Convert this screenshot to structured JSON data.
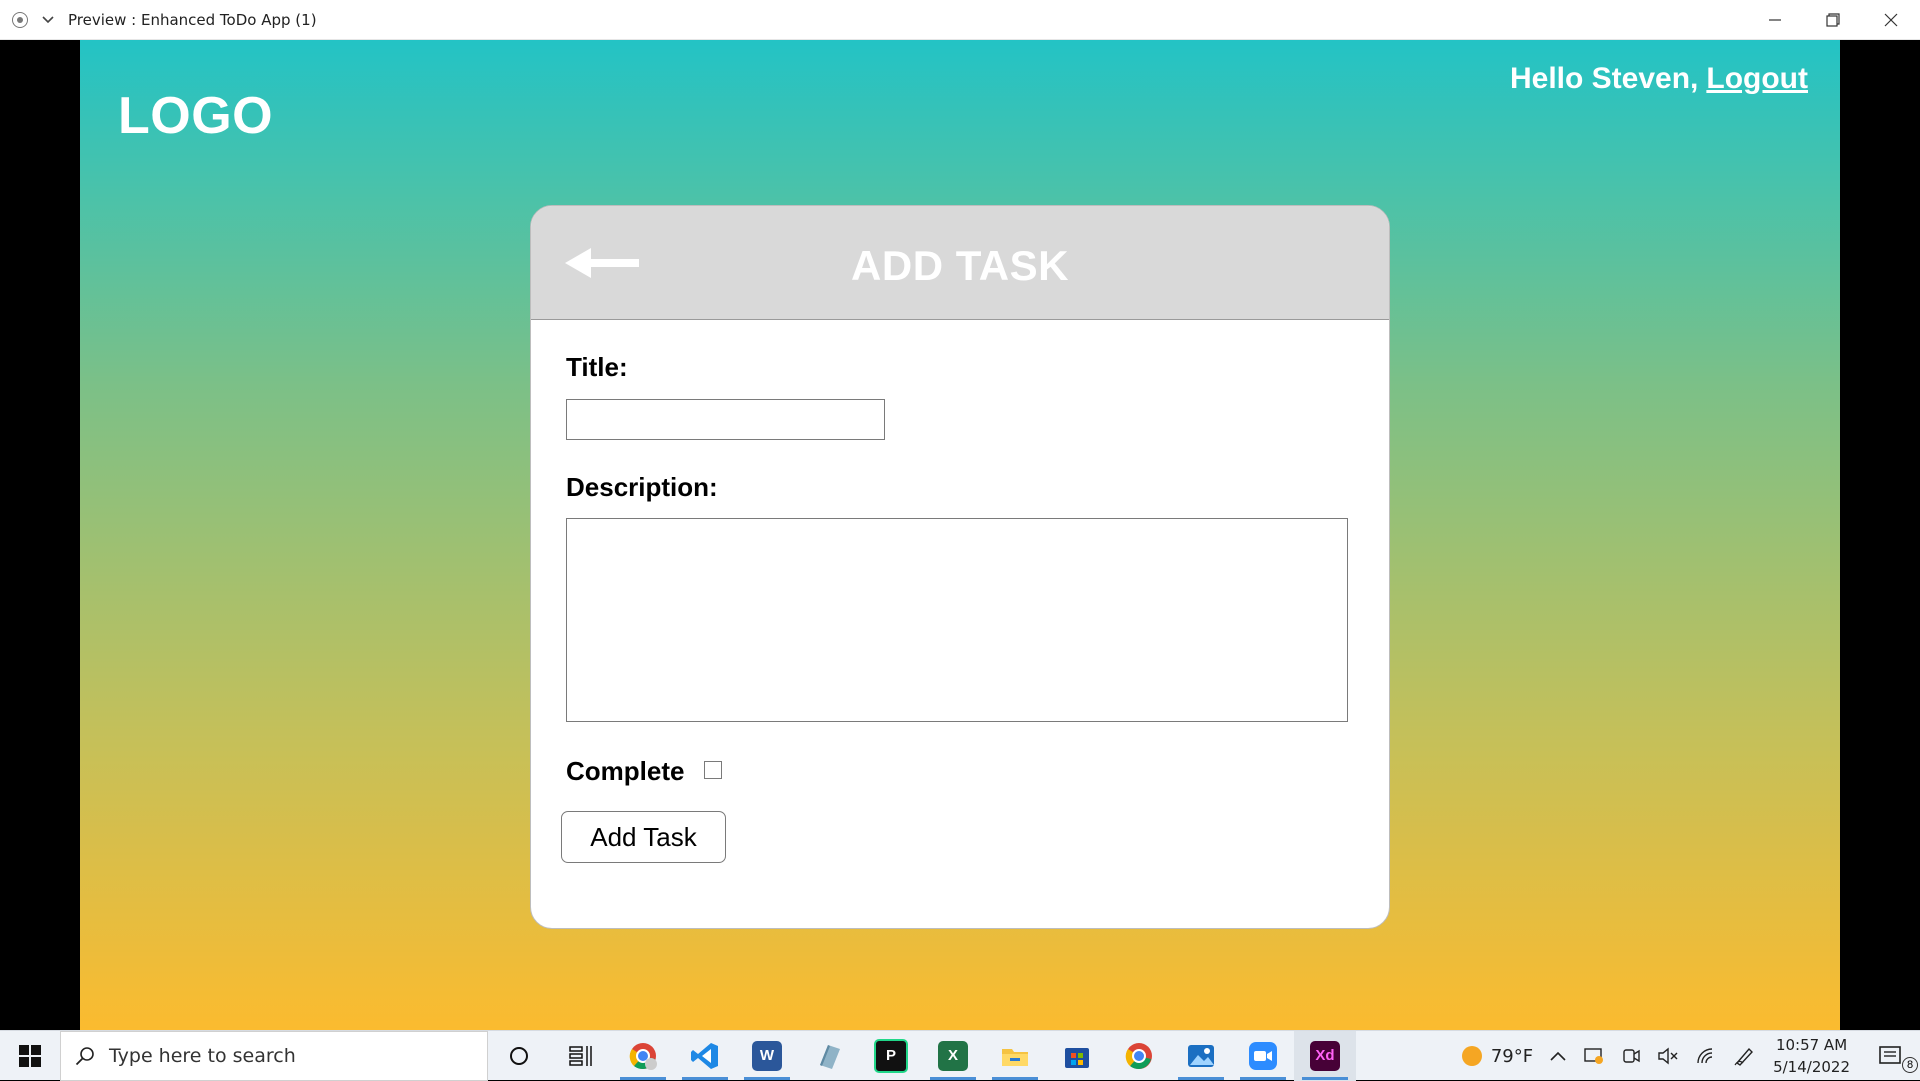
{
  "window": {
    "title": "Preview : Enhanced ToDo App (1)",
    "controls": [
      "minimize-icon",
      "restore-icon",
      "close-icon"
    ]
  },
  "header": {
    "logo": "LOGO",
    "greeting": "Hello Steven,",
    "logout_label": "Logout"
  },
  "card": {
    "title": "ADD TASK",
    "back_icon": "back-arrow-icon",
    "fields": {
      "title_label": "Title:",
      "title_value": "",
      "description_label": "Description:",
      "description_value": "",
      "complete_label": "Complete",
      "complete_checked": false
    },
    "submit_label": "Add Task"
  },
  "taskbar": {
    "search_placeholder": "Type here to search",
    "apps": [
      {
        "name": "chrome-profile",
        "active": true
      },
      {
        "name": "vscode",
        "active": true
      },
      {
        "name": "word",
        "label": "W",
        "active": true
      },
      {
        "name": "notepad",
        "active": false
      },
      {
        "name": "jetbrains",
        "label": "P",
        "active": false
      },
      {
        "name": "excel",
        "label": "X",
        "active": true
      },
      {
        "name": "file-explorer",
        "active": true
      },
      {
        "name": "store",
        "active": false
      },
      {
        "name": "chrome",
        "active": false
      },
      {
        "name": "photos",
        "active": true
      },
      {
        "name": "zoom",
        "active": true
      },
      {
        "name": "adobe-xd",
        "label": "Xd",
        "active": true
      }
    ],
    "weather_temp": "79°F",
    "time": "10:57 AM",
    "date": "5/14/2022",
    "notification_count": "8"
  },
  "colors": {
    "gradient_top": "#23c3c5",
    "gradient_bottom": "#fbbb2f",
    "card_header": "#d9d9d9"
  }
}
